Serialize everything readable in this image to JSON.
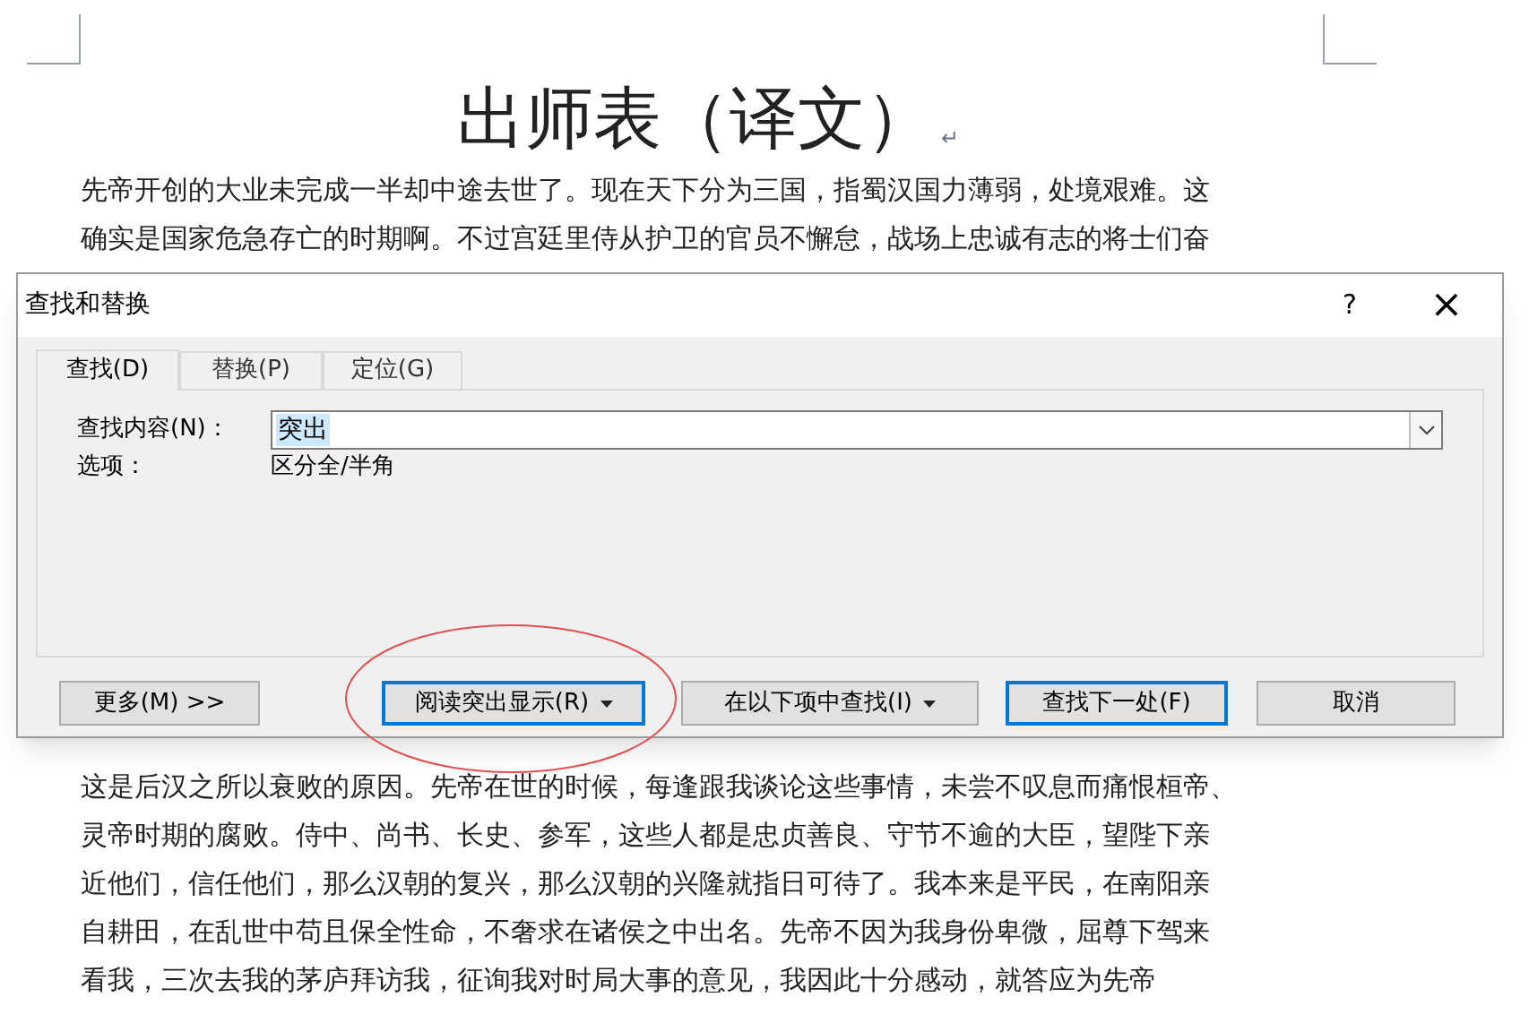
{
  "document": {
    "title": "出师表（译文）",
    "paragraph_mark": "↵",
    "lines_above": [
      "先帝开创的大业未完成一半却中途去世了。现在天下分为三国，指蜀汉国力薄弱，处境艰难。这",
      "确实是国家危急存亡的时期啊。不过宫廷里侍从护卫的官员不懈怠，战场上忠诚有志的将士们奋"
    ],
    "lines_below": [
      "这是后汉之所以衰败的原因。先帝在世的时候，每逢跟我谈论这些事情，未尝不叹息而痛恨桓帝、",
      "灵帝时期的腐败。侍中、尚书、长史、参军，这些人都是忠贞善良、守节不逾的大臣，望陛下亲",
      "近他们，信任他们，那么汉朝的复兴，那么汉朝的兴隆就指日可待了。我本来是平民，在南阳亲",
      "自耕田，在乱世中苟且保全性命，不奢求在诸侯之中出名。先帝不因为我身份卑微，屈尊下驾来",
      "看我，三次去我的茅庐拜访我，征询我对时局大事的意见，我因此十分感动，就答应为先帝"
    ]
  },
  "dialog": {
    "title": "查找和替换",
    "help": "?",
    "close": "×",
    "tabs": [
      {
        "label": "查找(D)",
        "selected": true
      },
      {
        "label": "替换(P)",
        "selected": false
      },
      {
        "label": "定位(G)",
        "selected": false
      }
    ],
    "find_label": "查找内容(N)：",
    "find_value": "突出",
    "options_label": "选项：",
    "options_value": "区分全/半角",
    "buttons": [
      {
        "label": "更多(M) >>",
        "kind": "plain"
      },
      {
        "label": "阅读突出显示(R)",
        "kind": "menu",
        "circled": true
      },
      {
        "label": "在以下项中查找(I)",
        "kind": "menu",
        "circled": false
      },
      {
        "label": "查找下一处(F)",
        "kind": "default"
      },
      {
        "label": "取消",
        "kind": "plain"
      }
    ]
  }
}
